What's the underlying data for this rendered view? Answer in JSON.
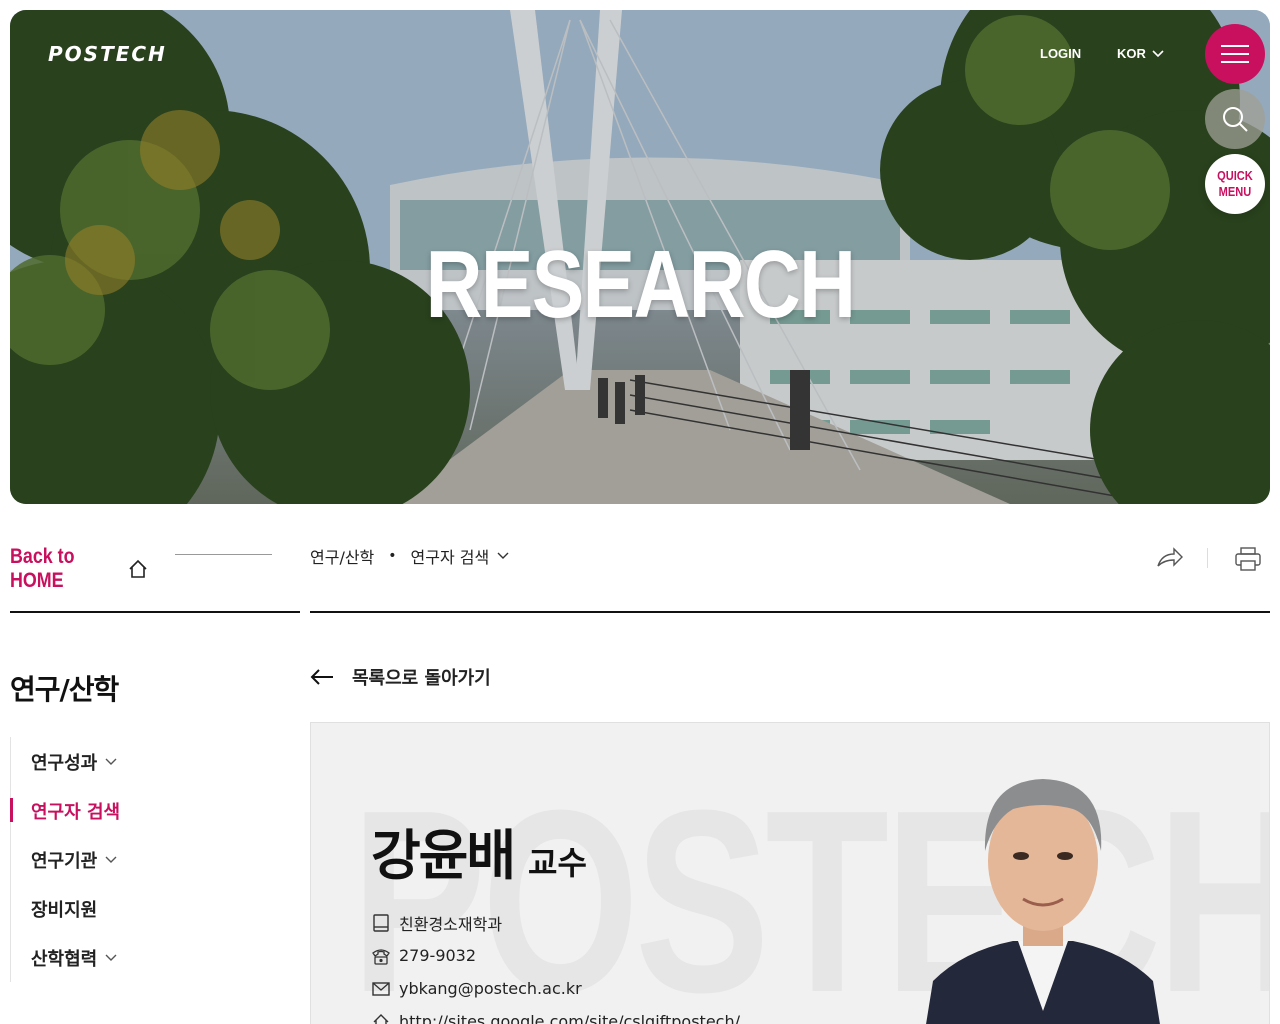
{
  "header": {
    "logo": "POSTECH",
    "login": "LOGIN",
    "language": "KOR",
    "hero_title": "RESEARCH",
    "quick_menu_line1": "QUICK",
    "quick_menu_line2": "MENU"
  },
  "nav": {
    "back_home": "Back to HOME",
    "breadcrumb_1": "연구/산학",
    "breadcrumb_separator": "•",
    "breadcrumb_2": "연구자 검색"
  },
  "sidebar": {
    "title": "연구/산학",
    "items": [
      {
        "label": "연구성과",
        "has_submenu": true,
        "active": false
      },
      {
        "label": "연구자 검색",
        "has_submenu": false,
        "active": true
      },
      {
        "label": "연구기관",
        "has_submenu": true,
        "active": false
      },
      {
        "label": "장비지원",
        "has_submenu": false,
        "active": false
      },
      {
        "label": "산학협력",
        "has_submenu": true,
        "active": false
      }
    ]
  },
  "main": {
    "back_to_list": "목록으로 돌아가기",
    "profile": {
      "watermark": "POSTECH",
      "name": "강윤배",
      "title": "교수",
      "department": "친환경소재학과",
      "phone": "279-9032",
      "email": "ybkang@postech.ac.kr",
      "homepage": "http://sites.google.com/site/cslgiftpostech/"
    }
  },
  "colors": {
    "accent": "#c8105f",
    "text": "#111111",
    "profile_bg": "#f1f1f1"
  },
  "icons": [
    "hamburger-icon",
    "search-icon",
    "home-icon",
    "chevron-down-icon",
    "share-icon",
    "print-icon",
    "arrow-left-icon",
    "book-icon",
    "phone-icon",
    "mail-icon",
    "home-icon"
  ]
}
